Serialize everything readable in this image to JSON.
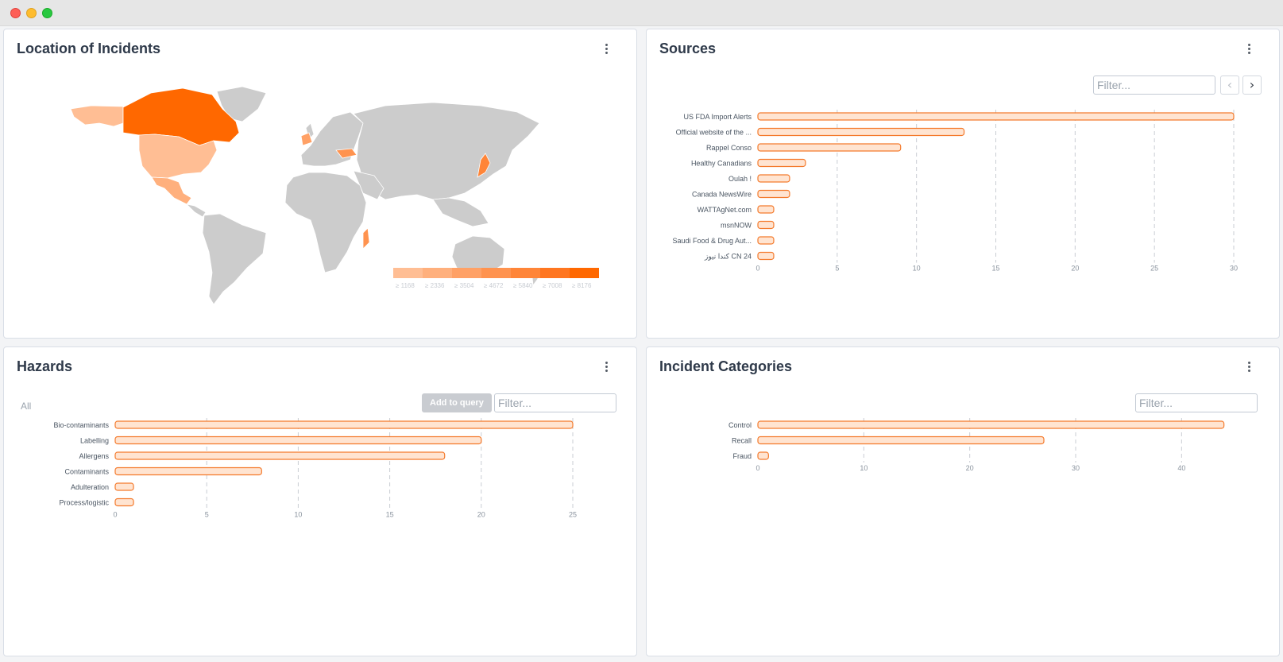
{
  "window": {
    "controls": [
      "close",
      "minimize",
      "maximize"
    ]
  },
  "theme": {
    "bar_fill": "#ffe4d1",
    "bar_stroke": "#f47a2c",
    "grid": "#c9cdd3",
    "map_land": "#cccccc",
    "map_borders": "#ffffff"
  },
  "location": {
    "title": "Location of Incidents",
    "legend": [
      {
        "label": "≥ 1168",
        "color": "#ffbe94"
      },
      {
        "label": "≥ 2336",
        "color": "#ffb07d"
      },
      {
        "label": "≥ 3504",
        "color": "#ffa166"
      },
      {
        "label": "≥ 4672",
        "color": "#ff934f"
      },
      {
        "label": "≥ 5840",
        "color": "#ff8538"
      },
      {
        "label": "≥ 7008",
        "color": "#ff7620"
      },
      {
        "label": "≥ 8176",
        "color": "#ff6800"
      }
    ]
  },
  "sources": {
    "title": "Sources",
    "filter_placeholder": "Filter...",
    "prev_icon": "chevron-left-icon",
    "next_icon": "chevron-right-icon",
    "chart_data": {
      "type": "bar",
      "orientation": "horizontal",
      "categories": [
        "US FDA Import Alerts",
        "Official website of the ...",
        "Rappel Conso",
        "Healthy Canadians",
        "Oulah !",
        "Canada NewsWire",
        "WATTAgNet.com",
        "msnNOW",
        "Saudi Food & Drug Aut...",
        "كندا نيوز CN 24"
      ],
      "values": [
        30,
        13,
        9,
        3,
        2,
        2,
        1,
        1,
        1,
        1
      ],
      "xlim": [
        0,
        30
      ],
      "ticks": [
        0,
        5,
        10,
        15,
        20,
        25,
        30
      ],
      "grid": true
    }
  },
  "hazards": {
    "title": "Hazards",
    "all_label": "All",
    "add_to_query_label": "Add to query",
    "filter_placeholder": "Filter...",
    "chart_data": {
      "type": "bar",
      "orientation": "horizontal",
      "categories": [
        "Bio-contaminants",
        "Labelling",
        "Allergens",
        "Contaminants",
        "Adulteration",
        "Process/logistic"
      ],
      "values": [
        25,
        20,
        18,
        8,
        1,
        1
      ],
      "xlim": [
        0,
        25
      ],
      "ticks": [
        0,
        5,
        10,
        15,
        20,
        25
      ],
      "grid": true
    }
  },
  "categories": {
    "title": "Incident Categories",
    "filter_placeholder": "Filter...",
    "chart_data": {
      "type": "bar",
      "orientation": "horizontal",
      "categories": [
        "Control",
        "Recall",
        "Fraud"
      ],
      "values": [
        44,
        27,
        1
      ],
      "xlim": [
        0,
        45
      ],
      "ticks": [
        0,
        10,
        20,
        30,
        40
      ],
      "grid": true
    }
  }
}
